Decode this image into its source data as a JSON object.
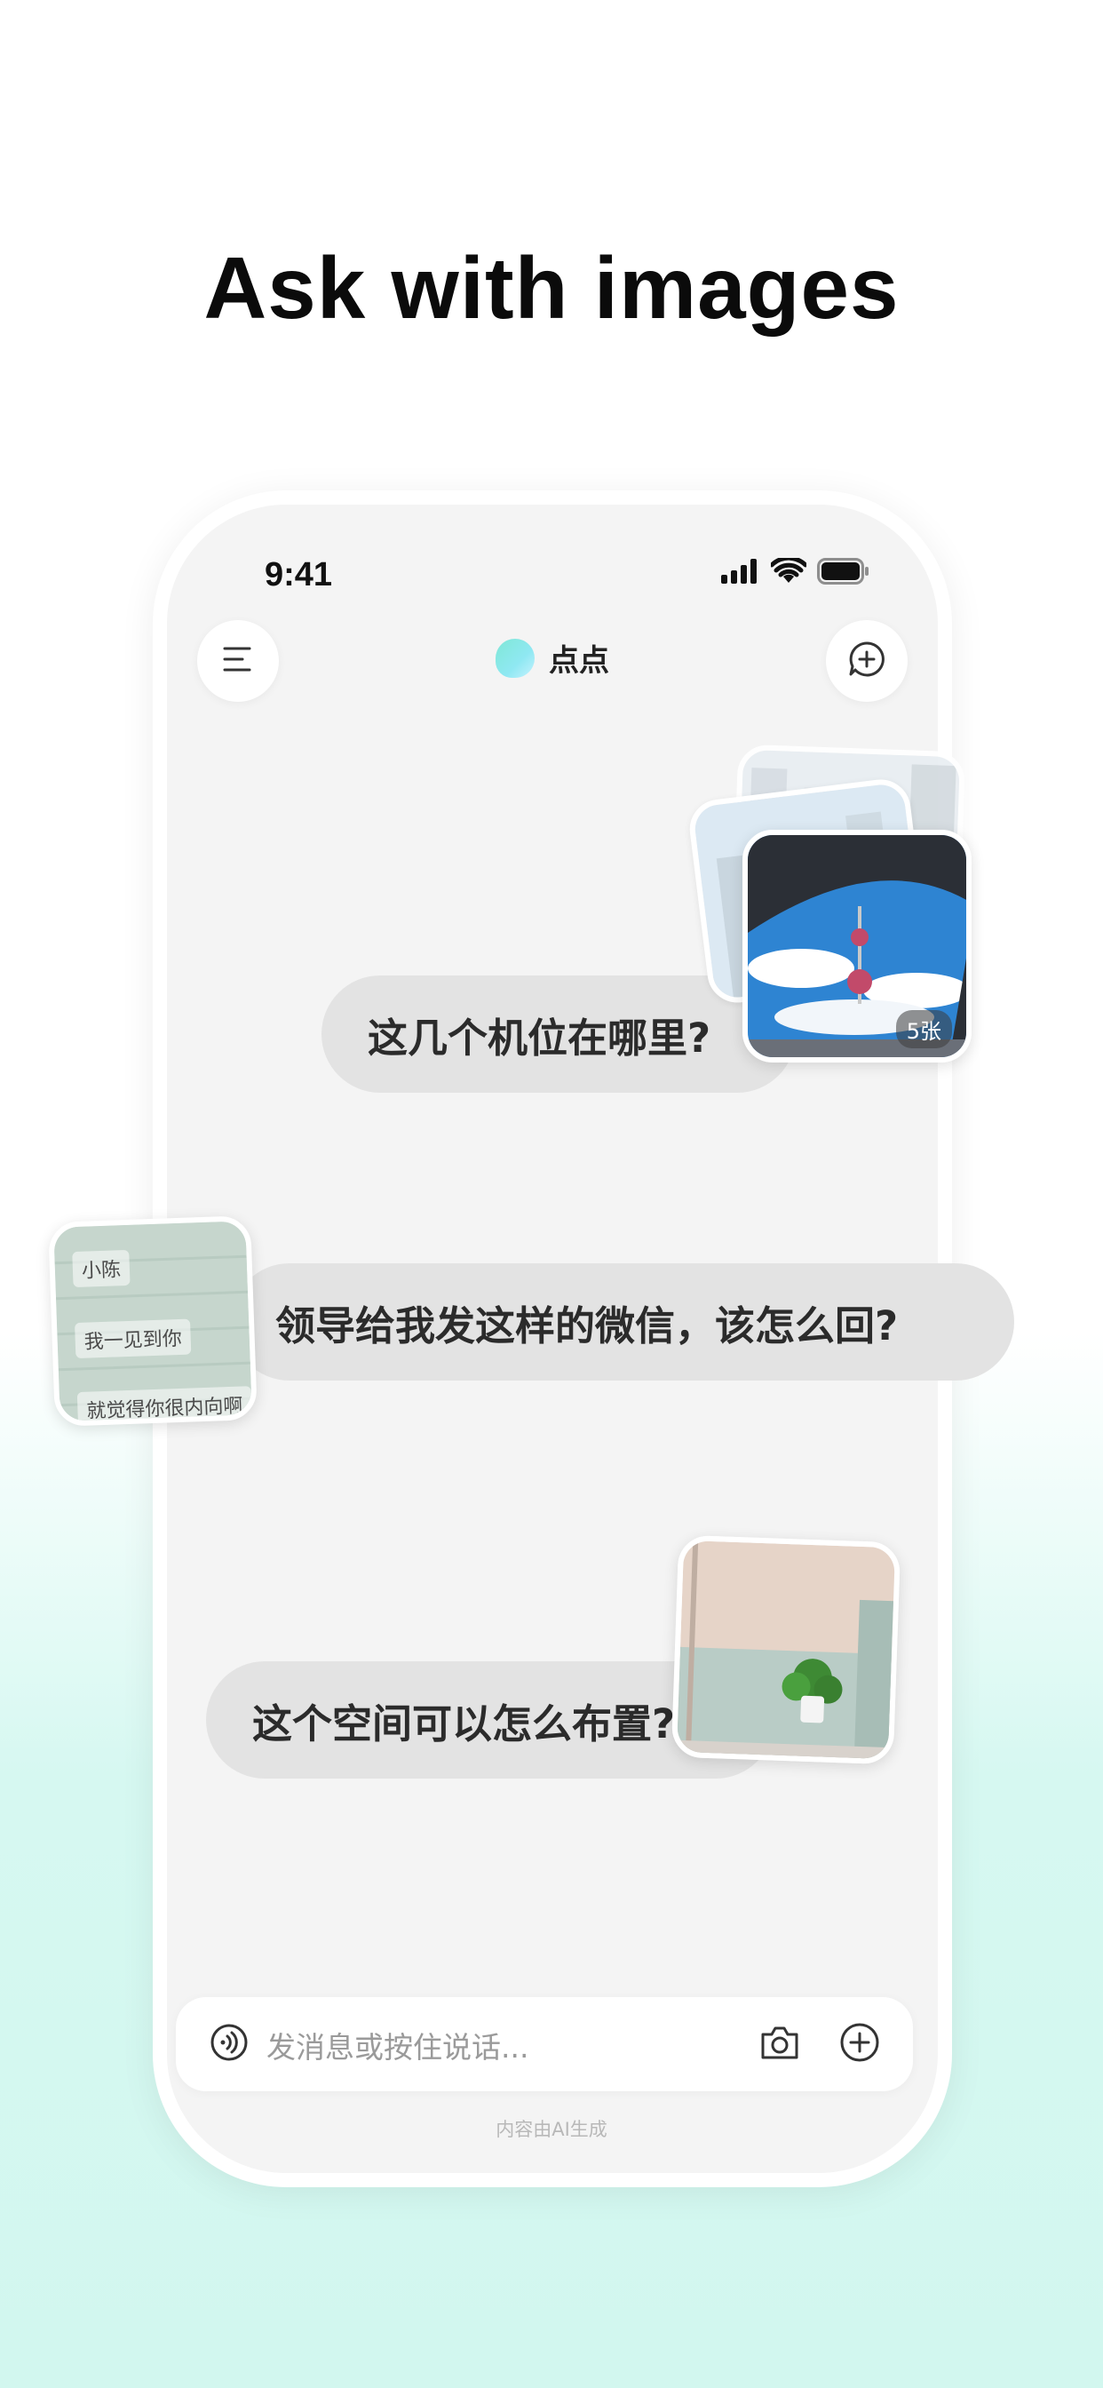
{
  "headline": "Ask with images",
  "status_bar": {
    "time": "9:41"
  },
  "header": {
    "app_name": "点点"
  },
  "messages": [
    {
      "text": "这几个机位在哪里?",
      "badge": "5张"
    },
    {
      "text": "领导给我发这样的微信，该怎么回?",
      "screenshot_lines": [
        "小陈",
        "我一见到你",
        "就觉得你很内向啊"
      ]
    },
    {
      "text": "这个空间可以怎么布置?"
    }
  ],
  "input": {
    "placeholder": "发消息或按住说话..."
  },
  "footer": {
    "disclaimer": "内容由AI生成"
  },
  "icons": [
    "menu-icon",
    "new-chat-icon",
    "voice-icon",
    "camera-icon",
    "plus-icon",
    "signal-icon",
    "wifi-icon",
    "battery-icon"
  ],
  "colors": {
    "bubble": "#e3e3e3",
    "screen_bg": "#f4f4f4",
    "accent": "#7fe7d6"
  }
}
